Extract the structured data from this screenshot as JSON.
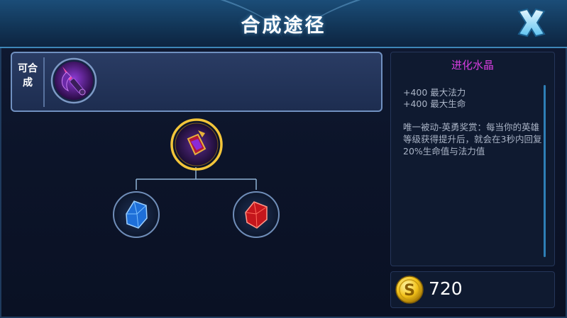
{
  "header": {
    "title": "合成途径"
  },
  "craft_panel": {
    "label": "可合成"
  },
  "detail": {
    "name": "进化水晶",
    "stats": [
      "+400 最大法力",
      "+400 最大生命"
    ],
    "passive": "唯一被动-英勇奖赏：每当你的英雄等级获得提升后，就会在3秒内回复20%生命值与法力值"
  },
  "price": {
    "amount": "720"
  },
  "icons": {
    "close": "close-x-icon",
    "craft_item": "purple-staff-item-icon",
    "root_item": "evolution-crystal-icon",
    "component_1": "blue-crystal-icon",
    "component_2": "red-crystal-icon",
    "coin": "gold-coin-icon"
  },
  "colors": {
    "item_name": "#d63ddf",
    "tree_line": "#8fb3d6",
    "selected_ring": "#f3c53a"
  }
}
